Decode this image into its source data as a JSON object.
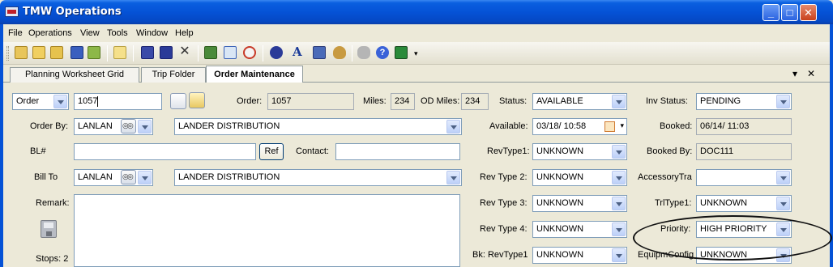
{
  "window": {
    "title": "TMW Operations",
    "minimize": "_",
    "maximize": "□",
    "close": "✕"
  },
  "menu": [
    "File",
    "Operations",
    "View",
    "Tools",
    "Window",
    "Help"
  ],
  "toolbar_icons": [
    "new-folder-icon",
    "open-folder-icon",
    "folder-icon",
    "save-icon",
    "export-icon",
    "note-icon",
    "book-icon",
    "index-icon",
    "delete-icon",
    "road-icon",
    "calendar-icon",
    "clock-icon",
    "runner-icon",
    "font-icon",
    "list-icon",
    "money-bag-icon",
    "hand-icon",
    "help-icon",
    "exit-icon"
  ],
  "tabs": [
    {
      "label": "Planning Worksheet Grid",
      "active": false
    },
    {
      "label": "Trip Folder",
      "active": false
    },
    {
      "label": "Order Maintenance",
      "active": true
    }
  ],
  "tab_tools": {
    "dropdown": "▾",
    "close": "✕"
  },
  "form": {
    "order_type": "Order",
    "order_number": "1057",
    "order_label": "Order:",
    "order_value": "1057",
    "miles_label": "Miles:",
    "miles_value": "234",
    "od_miles_label": "OD Miles:",
    "od_miles_value": "234",
    "status_label": "Status:",
    "status_value": "AVAILABLE",
    "inv_status_label": "Inv Status:",
    "inv_status_value": "PENDING",
    "order_by_label": "Order By:",
    "order_by_code": "LANLAN",
    "order_by_name": "LANDER DISTRIBUTION",
    "available_label": "Available:",
    "available_value": "03/18/    10:58",
    "booked_label": "Booked:",
    "booked_value": "06/14/    11:03",
    "bl_label": "BL#",
    "bl_value": "",
    "ref_button": "Ref",
    "contact_label": "Contact:",
    "contact_value": "",
    "revtype1_label": "RevType1:",
    "revtype1_value": "UNKNOWN",
    "booked_by_label": "Booked By:",
    "booked_by_value": "DOC111",
    "bill_to_label": "Bill To",
    "bill_to_code": "LANLAN",
    "bill_to_name": "LANDER DISTRIBUTION",
    "revtype2_label": "Rev Type 2:",
    "revtype2_value": "UNKNOWN",
    "accessory_label": "AccessoryTra",
    "accessory_value": "",
    "remark_label": "Remark:",
    "revtype3_label": "Rev Type 3:",
    "revtype3_value": "UNKNOWN",
    "trltype1_label": "TrlType1:",
    "trltype1_value": "UNKNOWN",
    "revtype4_label": "Rev Type 4:",
    "revtype4_value": "UNKNOWN",
    "priority_label": "Priority:",
    "priority_value": "HIGH PRIORITY",
    "stops_label": "Stops: 2",
    "bk_revtype1_label": "Bk: RevType1",
    "bk_revtype1_value": "UNKNOWN",
    "equip_config_label": "EquipmConfig",
    "equip_config_value": "UNKNOWN"
  }
}
